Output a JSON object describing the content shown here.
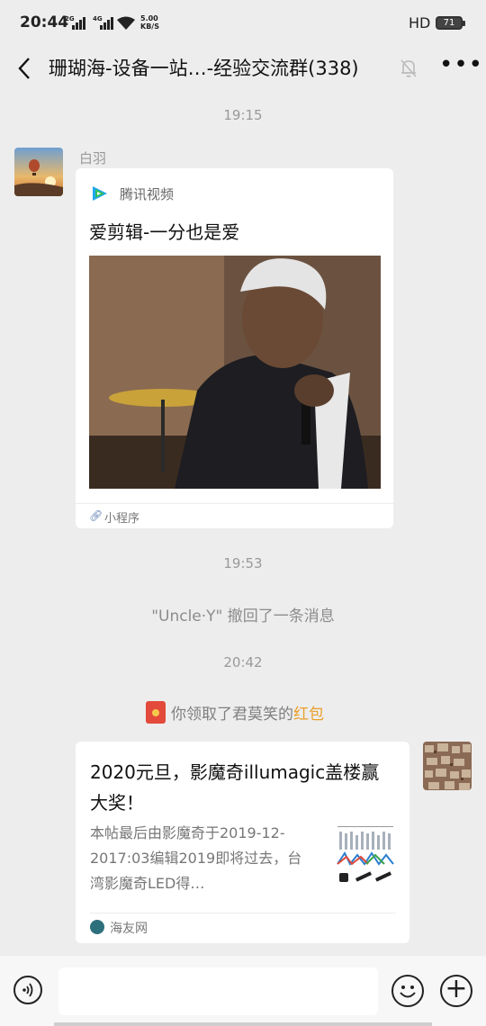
{
  "status_bar": {
    "time": "20:44",
    "sim1": "2G",
    "sim2": "4G",
    "speed_value": "5.00",
    "speed_unit": "KB/S",
    "hd": "HD",
    "battery": "71"
  },
  "header": {
    "title": "珊瑚海-设备一站…-经验交流群(338)"
  },
  "messages": {
    "time1": "19:15",
    "sender": "白羽",
    "mini_program": {
      "source": "腾讯视频",
      "title": "爱剪辑-一分也是爱",
      "footer": "小程序"
    },
    "time2": "19:53",
    "recall_notice": "\"Uncle·Y\" 撤回了一条消息",
    "time3": "20:42",
    "red_packet": {
      "text": "你领取了君莫笑的",
      "link": "红包"
    },
    "link_card": {
      "title": "2020元旦，影魔奇illumagic盖楼赢大奖！",
      "desc": "本帖最后由影魔奇于2019-12-2017:03编辑2019即将过去，台湾影魔奇LED得…",
      "site": "海友网"
    }
  },
  "input": {
    "placeholder": ""
  },
  "colors": {
    "background": "#ededed",
    "bubble": "#ffffff",
    "red_packet_link": "#e8a02c",
    "tencent_video_green": "#2fbf5a",
    "tencent_video_blue": "#22a6f2"
  },
  "icons": [
    "back-icon",
    "mute-icon",
    "more-icon",
    "tencent-video-icon",
    "link-icon",
    "red-packet-icon",
    "site-icon",
    "voice-icon",
    "emoji-icon",
    "plus-icon"
  ]
}
